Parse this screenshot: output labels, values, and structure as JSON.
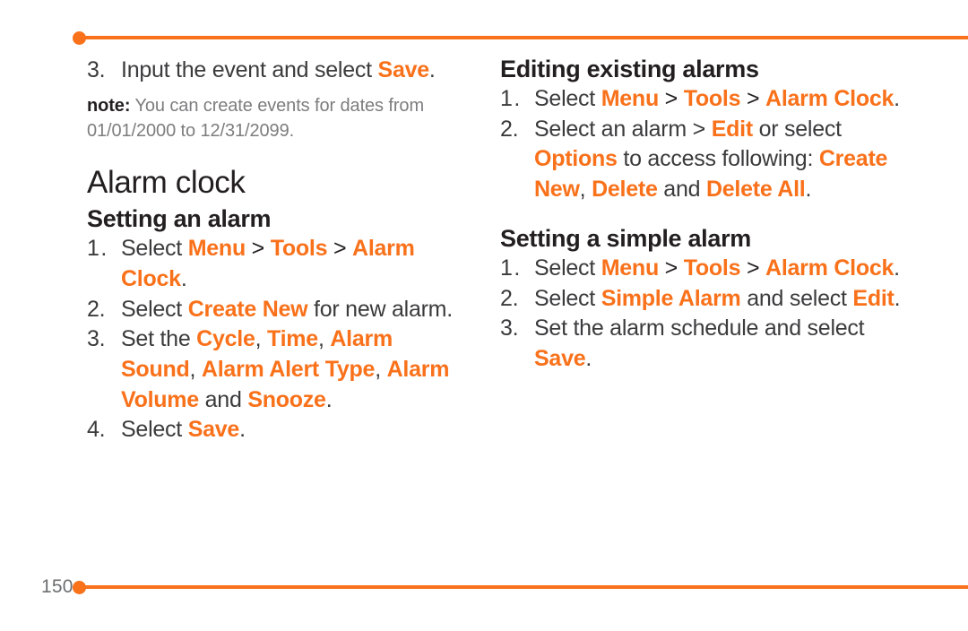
{
  "theme": {
    "accent": "#f9711a",
    "text": "#3b3b3d",
    "heading": "#231f20",
    "muted": "#7d7d7f",
    "background": "#ffffff"
  },
  "footer": {
    "page_number": "150"
  },
  "left_column": {
    "continued_list": {
      "items": [
        {
          "number": "3.",
          "parts": [
            {
              "text": "Input the event and select ",
              "style": "plain"
            },
            {
              "text": "Save",
              "style": "hl"
            },
            {
              "text": ".",
              "style": "plain"
            }
          ]
        }
      ]
    },
    "note": {
      "label": "note:",
      "text": " You can create events for dates from 01/01/2000 to 12/31/2099."
    },
    "title": "Alarm clock",
    "sections": [
      {
        "heading": "Setting an alarm",
        "items": [
          {
            "number": "1.",
            "parts": [
              {
                "text": "Select ",
                "style": "plain"
              },
              {
                "text": "Menu",
                "style": "hl"
              },
              {
                "text": " > ",
                "style": "sep"
              },
              {
                "text": "Tools",
                "style": "hl"
              },
              {
                "text": " > ",
                "style": "sep"
              },
              {
                "text": "Alarm Clock",
                "style": "hl"
              },
              {
                "text": ".",
                "style": "plain"
              }
            ]
          },
          {
            "number": "2.",
            "parts": [
              {
                "text": "Select ",
                "style": "plain"
              },
              {
                "text": "Create New",
                "style": "hl"
              },
              {
                "text": " for new alarm.",
                "style": "plain"
              }
            ]
          },
          {
            "number": "3.",
            "parts": [
              {
                "text": "Set the ",
                "style": "plain"
              },
              {
                "text": "Cycle",
                "style": "hl"
              },
              {
                "text": ", ",
                "style": "plain"
              },
              {
                "text": "Time",
                "style": "hl"
              },
              {
                "text": ", ",
                "style": "plain"
              },
              {
                "text": "Alarm Sound",
                "style": "hl"
              },
              {
                "text": ", ",
                "style": "plain"
              },
              {
                "text": "Alarm Alert Type",
                "style": "hl"
              },
              {
                "text": ", ",
                "style": "plain"
              },
              {
                "text": "Alarm Volume",
                "style": "hl"
              },
              {
                "text": " and ",
                "style": "plain"
              },
              {
                "text": "Snooze",
                "style": "hl"
              },
              {
                "text": ".",
                "style": "plain"
              }
            ]
          },
          {
            "number": "4.",
            "parts": [
              {
                "text": "Select ",
                "style": "plain"
              },
              {
                "text": "Save",
                "style": "hl"
              },
              {
                "text": ".",
                "style": "plain"
              }
            ]
          }
        ]
      }
    ]
  },
  "right_column": {
    "sections": [
      {
        "heading": "Editing existing alarms",
        "items": [
          {
            "number": "1.",
            "parts": [
              {
                "text": "Select ",
                "style": "plain"
              },
              {
                "text": "Menu",
                "style": "hl"
              },
              {
                "text": " > ",
                "style": "sep"
              },
              {
                "text": "Tools",
                "style": "hl"
              },
              {
                "text": " > ",
                "style": "sep"
              },
              {
                "text": "Alarm Clock",
                "style": "hl"
              },
              {
                "text": ".",
                "style": "plain"
              }
            ]
          },
          {
            "number": "2.",
            "parts": [
              {
                "text": "Select an alarm > ",
                "style": "plain"
              },
              {
                "text": "Edit",
                "style": "hl"
              },
              {
                "text": " or select ",
                "style": "plain"
              },
              {
                "text": "Options",
                "style": "hl"
              },
              {
                "text": " to access following: ",
                "style": "plain"
              },
              {
                "text": "Create New",
                "style": "hl"
              },
              {
                "text": ", ",
                "style": "plain"
              },
              {
                "text": "Delete",
                "style": "hl"
              },
              {
                "text": " and ",
                "style": "plain"
              },
              {
                "text": "Delete All",
                "style": "hl"
              },
              {
                "text": ".",
                "style": "plain"
              }
            ]
          }
        ]
      },
      {
        "heading": "Setting a simple alarm",
        "items": [
          {
            "number": "1.",
            "parts": [
              {
                "text": "Select ",
                "style": "plain"
              },
              {
                "text": "Menu",
                "style": "hl"
              },
              {
                "text": " > ",
                "style": "sep"
              },
              {
                "text": "Tools",
                "style": "hl"
              },
              {
                "text": " > ",
                "style": "sep"
              },
              {
                "text": "Alarm Clock",
                "style": "hl"
              },
              {
                "text": ".",
                "style": "plain"
              }
            ]
          },
          {
            "number": "2.",
            "parts": [
              {
                "text": "Select ",
                "style": "plain"
              },
              {
                "text": "Simple Alarm",
                "style": "hl"
              },
              {
                "text": " and select ",
                "style": "plain"
              },
              {
                "text": "Edit",
                "style": "hl"
              },
              {
                "text": ".",
                "style": "plain"
              }
            ]
          },
          {
            "number": "3.",
            "parts": [
              {
                "text": "Set the alarm schedule and select ",
                "style": "plain"
              },
              {
                "text": "Save",
                "style": "hl"
              },
              {
                "text": ".",
                "style": "plain"
              }
            ]
          }
        ]
      }
    ]
  }
}
